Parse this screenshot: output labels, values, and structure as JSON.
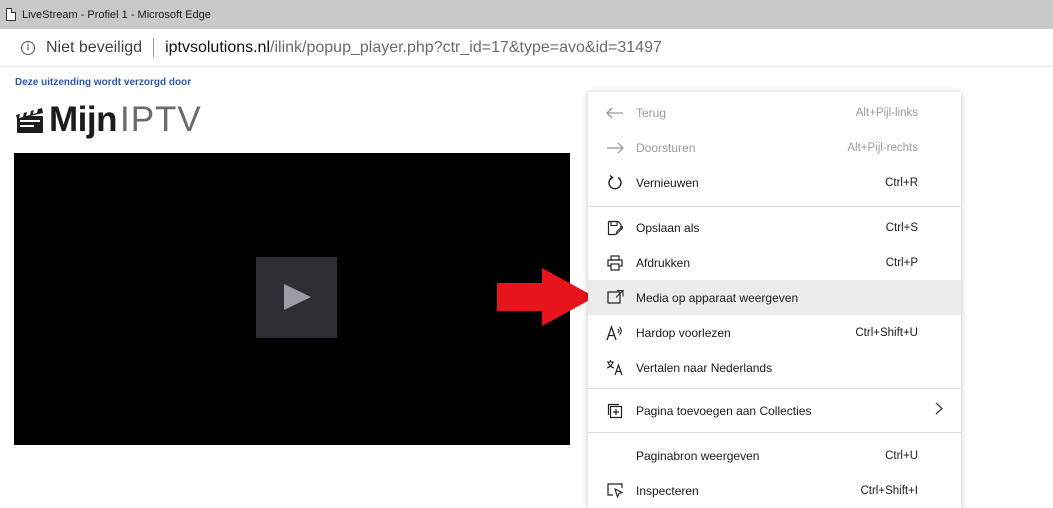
{
  "window": {
    "title": "LiveStream - Profiel 1 - Microsoft Edge"
  },
  "address_bar": {
    "security_label": "Niet beveiligd",
    "url_domain": "iptvsolutions.nl",
    "url_path": "/ilink/popup_player.php?ctr_id=17&type=avo&id=31497",
    "icons": [
      "info-icon"
    ]
  },
  "page": {
    "sponsor_text": "Deze uitzending wordt verzorgd door",
    "logo_text_bold": "Mijn",
    "logo_text_light": "IPTV",
    "video": {
      "state": "paused",
      "icons": [
        "play-icon"
      ]
    }
  },
  "context_menu": {
    "items": [
      {
        "label": "Terug",
        "shortcut": "Alt+Pijl-links",
        "icon": "arrow-left-icon",
        "disabled": true
      },
      {
        "label": "Doorsturen",
        "shortcut": "Alt+Pijl-rechts",
        "icon": "arrow-right-icon",
        "disabled": true
      },
      {
        "label": "Vernieuwen",
        "shortcut": "Ctrl+R",
        "icon": "refresh-icon",
        "disabled": false
      },
      {
        "label": "Opslaan als",
        "shortcut": "Ctrl+S",
        "icon": "save-as-icon",
        "disabled": false
      },
      {
        "label": "Afdrukken",
        "shortcut": "Ctrl+P",
        "icon": "printer-icon",
        "disabled": false
      },
      {
        "label": "Media op apparaat weergeven",
        "shortcut": "",
        "icon": "cast-icon",
        "disabled": false,
        "highlighted": true
      },
      {
        "label": "Hardop voorlezen",
        "shortcut": "Ctrl+Shift+U",
        "icon": "read-aloud-icon",
        "disabled": false
      },
      {
        "label": "Vertalen naar Nederlands",
        "shortcut": "",
        "icon": "translate-icon",
        "disabled": false
      },
      {
        "label": "Pagina toevoegen aan Collecties",
        "shortcut": "",
        "icon": "collections-icon",
        "disabled": false,
        "submenu": true
      },
      {
        "label": "Paginabron weergeven",
        "shortcut": "Ctrl+U",
        "icon": "",
        "disabled": false
      },
      {
        "label": "Inspecteren",
        "shortcut": "Ctrl+Shift+I",
        "icon": "inspect-icon",
        "disabled": false
      }
    ]
  },
  "annotation": {
    "arrow_color": "#e8141b",
    "icons": [
      "red-arrow-icon"
    ]
  },
  "colors": {
    "titlebar_bg": "#c9c9c9",
    "sponsor_text": "#2b5aa8",
    "menu_highlight": "#ececec",
    "video_bg": "#000000"
  }
}
